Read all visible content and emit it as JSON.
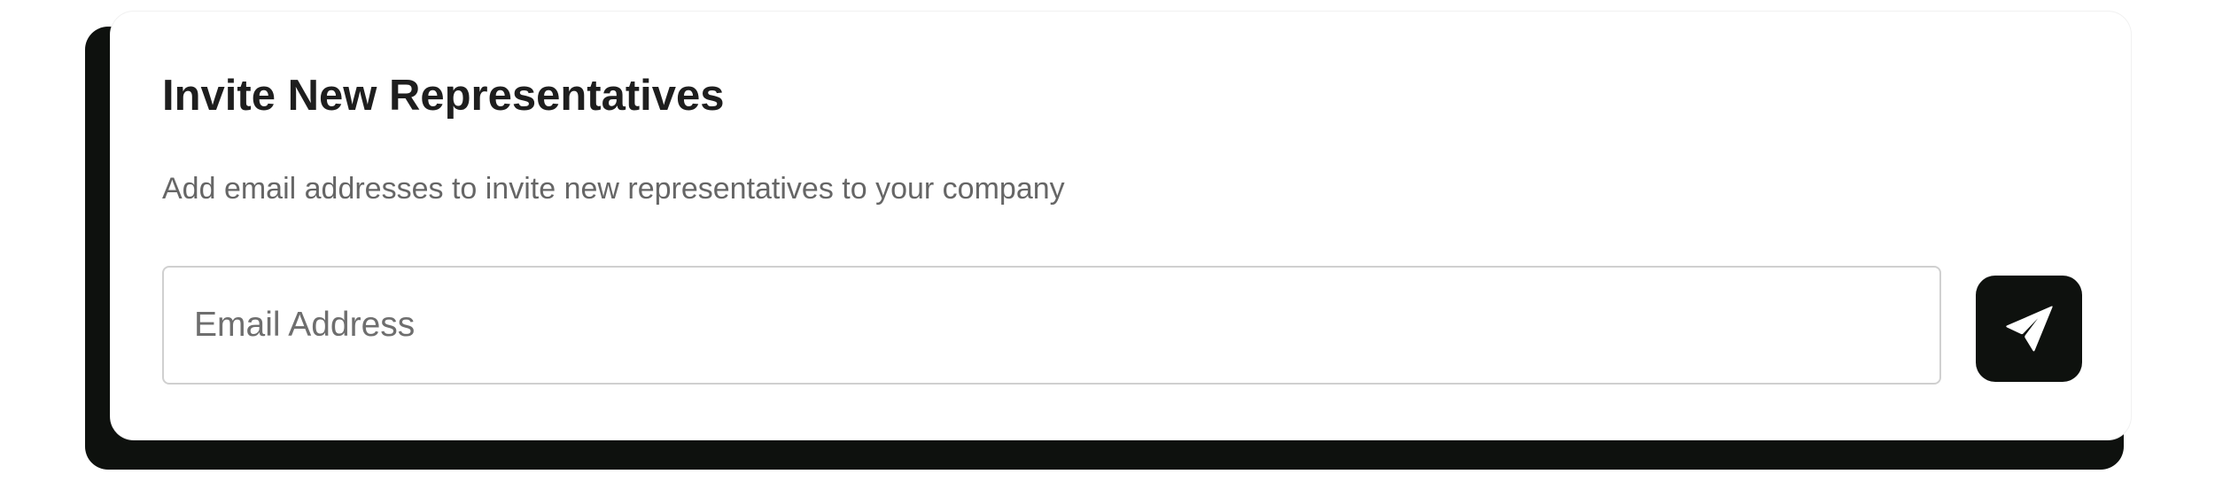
{
  "invite_card": {
    "title": "Invite New Representatives",
    "description": "Add email addresses to invite new representatives to your company",
    "email_input": {
      "placeholder": "Email Address",
      "value": ""
    },
    "send_button": {
      "icon": "paper-plane-icon"
    }
  },
  "colors": {
    "card_background": "#ffffff",
    "shadow": "#0e110e",
    "button_background": "#0e110e",
    "title_text": "#1e1e1e",
    "subtitle_text": "#666666",
    "input_border": "#d0d0d0"
  }
}
